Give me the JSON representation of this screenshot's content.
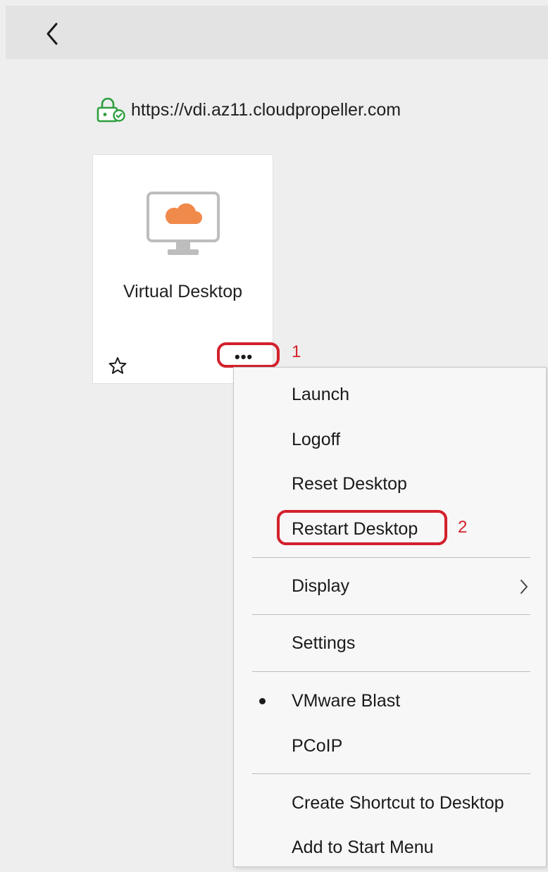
{
  "server": {
    "url": "https://vdi.az11.cloudpropeller.com",
    "icon": "secure-lock-icon"
  },
  "desktop_tile": {
    "name": "Virtual Desktop",
    "more_label": "•••",
    "icon": "monitor-cloud-icon",
    "accent_color": "#f08a4b"
  },
  "context_menu": {
    "items": [
      {
        "label": "Launch"
      },
      {
        "label": "Logoff"
      },
      {
        "label": "Reset Desktop"
      },
      {
        "label": "Restart Desktop"
      },
      {
        "label": "Display"
      },
      {
        "label": "Settings"
      },
      {
        "label": "VMware Blast"
      },
      {
        "label": "PCoIP"
      },
      {
        "label": "Create Shortcut to Desktop"
      },
      {
        "label": "Add to Start Menu"
      }
    ]
  },
  "annotations": {
    "step1": "1",
    "step2": "2",
    "color": "#d3212d"
  }
}
